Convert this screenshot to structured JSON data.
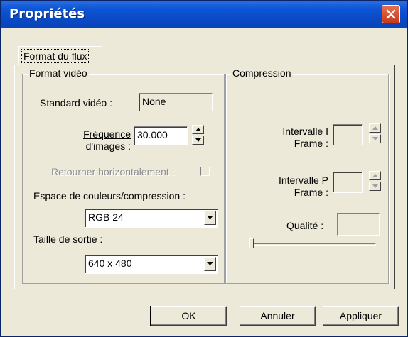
{
  "window": {
    "title": "Propriétés"
  },
  "tabs": [
    {
      "label": "Format du flux",
      "selected": true
    }
  ],
  "video_format": {
    "legend": "Format vidéo",
    "standard_label": "Standard vidéo :",
    "standard_value": "None",
    "frame_rate_label_line1": "Fréquence",
    "frame_rate_label_line2": "d'images :",
    "frame_rate_value": "30.000",
    "flip_label": "Retourner horizontalement :",
    "flip_checked": false,
    "colorspace_label": "Espace de couleurs/compression :",
    "colorspace_value": "RGB 24",
    "output_size_label": "Taille de sortie :",
    "output_size_value": "640 x 480"
  },
  "compression": {
    "legend": "Compression",
    "iframe_label_line1": "Intervalle I",
    "iframe_label_line2": "Frame :",
    "iframe_value": "",
    "pframe_label_line1": "Intervalle P",
    "pframe_label_line2": "Frame :",
    "pframe_value": "",
    "quality_label": "Qualité :",
    "quality_value": "",
    "quality_slider_level": 0
  },
  "buttons": {
    "ok": "OK",
    "cancel": "Annuler",
    "apply": "Appliquer"
  },
  "icons": {
    "close": "close-icon",
    "spin_up": "up-arrow-icon",
    "spin_down": "down-arrow-icon",
    "dropdown": "chevron-down-icon"
  },
  "colors": {
    "titlebar": "#0a49c4",
    "close_button": "#d4431f",
    "dialog_bg": "#ece9d8"
  }
}
